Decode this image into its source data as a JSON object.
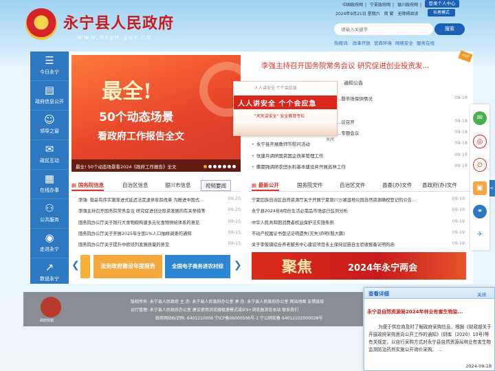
{
  "header": {
    "site_title": "永宁县人民政府",
    "site_url": "www.nxyn.gov.cn",
    "top_links": [
      "中国政府网",
      "|",
      "宁夏政府网",
      "|",
      "银川政府网",
      "|"
    ],
    "personal_center": "登录个人中心",
    "date": "2024年9月21日 星期六",
    "simp_trad": "简 繁",
    "accessible": "无障碍阅读",
    "elder_mode": "长者模式",
    "search_placeholder": "请输入关键字",
    "search_button": "搜索",
    "hot_words": [
      "热搜词:",
      "改革开放",
      "营商环境",
      "网络安全",
      "服务在线"
    ]
  },
  "left_nav": [
    {
      "icon": "list-icon",
      "glyph": "☰",
      "label": "今日永宁"
    },
    {
      "icon": "clipboard-icon",
      "glyph": "▤",
      "label": "政府信息公开"
    },
    {
      "icon": "people-icon",
      "glyph": "☺",
      "label": "领导之窗"
    },
    {
      "icon": "chat-icon",
      "glyph": "✉",
      "label": "政民互动"
    },
    {
      "icon": "calendar-icon",
      "glyph": "▦",
      "label": "在线办事"
    },
    {
      "icon": "service-icon",
      "glyph": "⚇",
      "label": "公共服务"
    },
    {
      "icon": "location-icon",
      "glyph": "◉",
      "label": "走进永宁"
    },
    {
      "icon": "chart-icon",
      "glyph": "↗",
      "label": "数说永宁"
    }
  ],
  "hero": {
    "line1": "最全!",
    "line2": "50个动态场景",
    "line3": "看政府工作报告全文",
    "caption": "最全! 50个动态场景看2024《政府工作报告》全文"
  },
  "headline": "李强主持召开国务院常务会议 研究促进创业投资发...",
  "hot_badge": "HOT",
  "right_top_tabs": [
    "通知公告"
  ],
  "right_top_list": [
    {
      "text": "...暨市场保供情况",
      "date": "09-18"
    },
    {
      "text": "...议召开",
      "date": "09-18"
    },
    {
      "text": "...专题会议",
      "date": "09-18"
    },
    {
      "text": "永宁县开展教师节慰问活动",
      "date": "09-18"
    },
    {
      "text": "张建兵调研国资国企改革管理工作",
      "date": "09-18"
    },
    {
      "text": "撒都强调研农田水利基本建设并开展巡林工作",
      "date": "09-18"
    }
  ],
  "safety_popup": {
    "top": "人人讲安全 个个会应急",
    "main": "人人讲安全 个个会应急",
    "sub": "\"天天讲安全\" 安全教育专栏",
    "close": "关闭"
  },
  "left_tabs": [
    "国务院信息",
    "自治区信息",
    "银川市信息",
    "视频要闻"
  ],
  "left_list": [
    {
      "text": "李强: 稳妥有序实施渐进式延迟法定退休年龄改革 为推进中国式...",
      "date": "09-20"
    },
    {
      "text": "李强主持召开国务院常务会议 研究促进创业投资发展的有关举措等",
      "date": "09-20"
    },
    {
      "text": "国务院办公厅关于践行大食物观构建多元化食物供给体系的意见",
      "date": "09-15"
    },
    {
      "text": "国务院办公厅关于开展2025年全国1%人口抽样调查的通知",
      "date": "09-15"
    },
    {
      "text": "国务院办公厅关于提升中欧班列发展质量的意见",
      "date": "09-15"
    },
    {
      "text": "国务院印发《关于加强监管防范风险推动保险业高质量发展的若...",
      "date": "09-12"
    }
  ],
  "right_tabs": [
    "最新公开",
    "国务院文件",
    "自治区文件",
    "县委(办)文件",
    "县政府(办)文件"
  ],
  "right_list": [
    {
      "text": "宁夏回族自治区自然资源厅关于开展宁夏银川沙湖湿地公园自然资源确权登记的公告...",
      "date": "09-19"
    },
    {
      "text": "永宁县2024年8月份生活必需品市场运行监测分析",
      "date": "09-19"
    },
    {
      "text": "中华人民共和国消费者权益保护法实施条例",
      "date": "09-19"
    },
    {
      "text": "不动产权属证书登记证明遗失(灭失)声明(殷大鹏)",
      "date": "09-19"
    },
    {
      "text": "关于李俊镇综合养老服务中心建设项目永土保持设施自主验收报备证明的函",
      "date": "09-19"
    }
  ],
  "banners": {
    "law": "法治政府建设年度报告",
    "trade": "全国电子商务进农村综",
    "focus_big": "聚焦",
    "focus_sub": "2024年永宁两会"
  },
  "side_float": {
    "tab_glyph": "<",
    "icons": [
      "wechat-icon",
      "weibo-icon",
      "app-icon",
      "toutiao-icon",
      "share-icon",
      "bird-icon"
    ]
  },
  "footer": {
    "line1": "版权所有: 永宁县人民政府 主 办: 永宁县人民政府办公室 承 办: 永宁县人民政府办公室   网站地图   友情链接",
    "line2": "运行管理: 永宁县人民政府办公室 建议使用浏览器极速模式或IE9+浏览器浏览本站 联系我们",
    "line3": "政府网站标识码: 6401210006    宁ICP备06000506号-1    宁公网安备 64012102000028号",
    "seal_label": "政府找错"
  },
  "notice": {
    "title": "查看详细",
    "close": "关闭",
    "headline": "永宁县自然资源局2024年林业有害生物监...",
    "body": "为便于供应商及时了解政府采购信息，根据《财政部关于开展政府采购意向公开工作的通知》(财库〔2020〕10号)等有关规定，以自行采购方式对永宁县自然资源局林业有害生物监测防治药剂实施公开询价采购。 ...",
    "date": "2024-09-18"
  },
  "colors": {
    "brand_red": "#c81c1c",
    "nav_blue": "#2d78c0",
    "accent_orange": "#f09a2a"
  }
}
